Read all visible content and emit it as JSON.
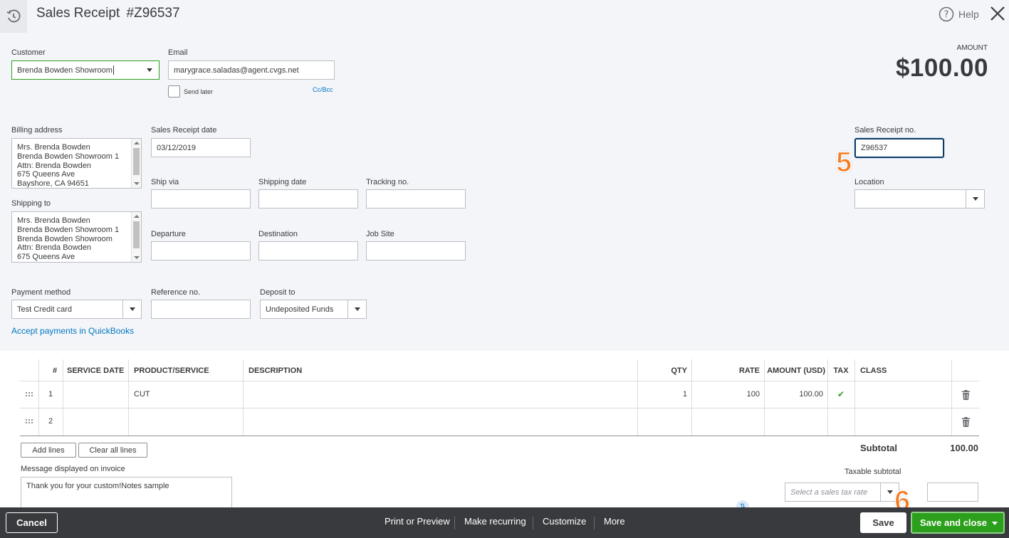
{
  "header": {
    "title": "Sales Receipt",
    "number": "#Z96537",
    "help_label": "Help"
  },
  "customer": {
    "label": "Customer",
    "value": "Brenda Bowden Showroom"
  },
  "email": {
    "label": "Email",
    "value": "marygrace.saladas@agent.cvgs.net",
    "send_later": "Send later",
    "cc_bcc": "Cc/Bcc"
  },
  "amount": {
    "label": "AMOUNT",
    "value": "$100.00"
  },
  "billing": {
    "label": "Billing address",
    "lines": [
      "Mrs. Brenda Bowden",
      "Brenda Bowden Showroom 1",
      "Attn: Brenda Bowden",
      "675 Queens Ave",
      "Bayshore, CA  94651"
    ]
  },
  "shipping": {
    "label": "Shipping to",
    "lines": [
      "Mrs. Brenda Bowden",
      "Brenda Bowden Showroom 1",
      "Brenda Bowden Showroom",
      "Attn: Brenda Bowden",
      "675 Queens Ave"
    ]
  },
  "receipt_date": {
    "label": "Sales Receipt date",
    "value": "03/12/2019"
  },
  "receipt_no": {
    "label": "Sales Receipt no.",
    "value": "Z96537"
  },
  "ship_via": {
    "label": "Ship via",
    "value": ""
  },
  "shipping_date": {
    "label": "Shipping date",
    "value": ""
  },
  "tracking_no": {
    "label": "Tracking no.",
    "value": ""
  },
  "location": {
    "label": "Location",
    "value": ""
  },
  "departure": {
    "label": "Departure",
    "value": ""
  },
  "destination": {
    "label": "Destination",
    "value": ""
  },
  "job_site": {
    "label": "Job Site",
    "value": ""
  },
  "payment_method": {
    "label": "Payment method",
    "value": "Test Credit card"
  },
  "reference_no": {
    "label": "Reference no.",
    "value": ""
  },
  "deposit_to": {
    "label": "Deposit to",
    "value": "Undeposited Funds"
  },
  "accept_payments": "Accept payments in QuickBooks",
  "table": {
    "headers": [
      "#",
      "SERVICE DATE",
      "PRODUCT/SERVICE",
      "DESCRIPTION",
      "QTY",
      "RATE",
      "AMOUNT (USD)",
      "TAX",
      "CLASS"
    ],
    "rows": [
      {
        "num": "1",
        "service_date": "",
        "product": "CUT",
        "description": "",
        "qty": "1",
        "rate": "100",
        "amount": "100.00",
        "tax": "✔",
        "class": ""
      },
      {
        "num": "2",
        "service_date": "",
        "product": "",
        "description": "",
        "qty": "",
        "rate": "",
        "amount": "",
        "tax": "",
        "class": ""
      }
    ]
  },
  "add_lines": "Add lines",
  "clear_lines": "Clear all lines",
  "subtotal": {
    "label": "Subtotal",
    "value": "100.00"
  },
  "message": {
    "label": "Message displayed on invoice",
    "value": "Thank you for your custom!Notes sample"
  },
  "taxable_subtotal": {
    "label": "Taxable subtotal",
    "placeholder": "Select a sales tax rate"
  },
  "badges": {
    "five": "5",
    "six": "6"
  },
  "footer": {
    "cancel": "Cancel",
    "print": "Print or Preview",
    "recurring": "Make recurring",
    "customize": "Customize",
    "more": "More",
    "save": "Save",
    "save_close": "Save and close"
  },
  "colors": {
    "accent_green": "#2ca01c",
    "footer_bg": "#393a3d",
    "link": "#0077c5",
    "badge": "#f47b20"
  }
}
